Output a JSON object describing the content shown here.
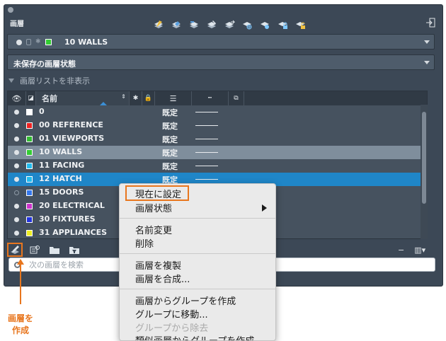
{
  "palette": {
    "title": "画層",
    "current_layer": {
      "name": "10 WALLS",
      "color": "#33cc33"
    },
    "layer_state": "未保存の画層状態",
    "toggle_list_label": "画層リストを非表示"
  },
  "toolbar_icons": [
    "layer-properties-icon",
    "layer-match-icon",
    "layer-previous-icon",
    "layer-isolate-icon",
    "layer-unisolate-icon",
    "layer-freeze-icon",
    "layer-off-icon",
    "layer-lock-icon",
    "layer-unlock-icon"
  ],
  "list": {
    "header": {
      "name": "名前"
    },
    "rows": [
      {
        "name": "0",
        "color": "#ffffff",
        "linetype": "既定",
        "on": true,
        "state": ""
      },
      {
        "name": "00 REFERENCE",
        "color": "#ee2222",
        "linetype": "既定",
        "on": true,
        "state": ""
      },
      {
        "name": "01 VIEWPORTS",
        "color": "#33bb33",
        "linetype": "既定",
        "on": true,
        "state": ""
      },
      {
        "name": "10 WALLS",
        "color": "#33cc33",
        "linetype": "既定",
        "on": true,
        "state": "selected"
      },
      {
        "name": "11 FACING",
        "color": "#22bbee",
        "linetype": "既定",
        "on": true,
        "state": ""
      },
      {
        "name": "12 HATCH",
        "color": "#22bbee",
        "linetype": "既定",
        "on": true,
        "state": "active"
      },
      {
        "name": "15 DOORS",
        "color": "#3377ee",
        "linetype": "",
        "on": false,
        "state": ""
      },
      {
        "name": "20 ELECTRICAL",
        "color": "#cc33cc",
        "linetype": "",
        "on": true,
        "state": ""
      },
      {
        "name": "30 FIXTURES",
        "color": "#2233dd",
        "linetype": "",
        "on": true,
        "state": ""
      },
      {
        "name": "31 APPLIANCES",
        "color": "#eeee22",
        "linetype": "",
        "on": true,
        "state": ""
      }
    ]
  },
  "search": {
    "placeholder": "次の画層を検索"
  },
  "context_menu": {
    "items": [
      {
        "label": "現在に設定",
        "disabled": false
      },
      {
        "label": "画層状態",
        "disabled": false,
        "submenu": true
      },
      {
        "label": "名前変更",
        "disabled": false
      },
      {
        "label": "削除",
        "disabled": false
      },
      {
        "label": "画層を複製",
        "disabled": false
      },
      {
        "label": "画層を合成...",
        "disabled": false
      },
      {
        "label": "画層からグループを作成",
        "disabled": false
      },
      {
        "label": "グループに移動...",
        "disabled": false
      },
      {
        "label": "グループから除去",
        "disabled": true
      },
      {
        "label": "類似画層からグループを作成",
        "disabled": false
      }
    ]
  },
  "callout": {
    "line1": "画層を",
    "line2": "作成"
  },
  "colors": {
    "accent": "#e8761e",
    "active_row": "#1f86c8",
    "palette_bg": "#3c4856"
  }
}
